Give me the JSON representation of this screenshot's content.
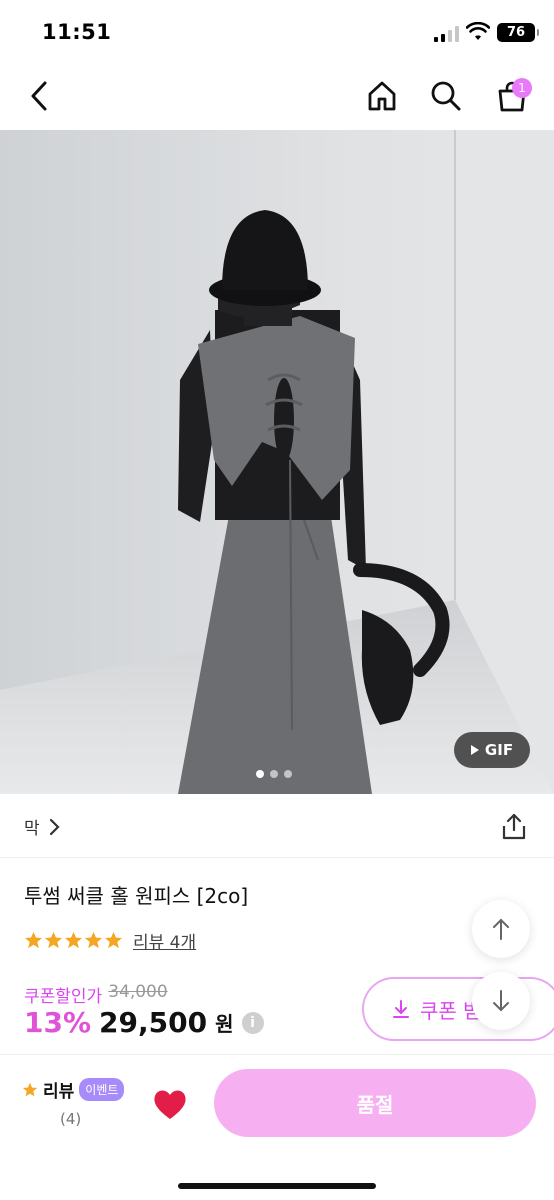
{
  "status_bar": {
    "time": "11:51",
    "battery": "76"
  },
  "nav": {
    "cart_count": "1"
  },
  "hero": {
    "gif_label": "GIF",
    "slide_count": 3,
    "active_slide": 0
  },
  "brand": {
    "name": "막",
    "chevron": ">"
  },
  "product": {
    "title": "투썸 써클 홀 원피스 [2co]",
    "rating": 5,
    "review_link": "리뷰 4개",
    "coupon_price_label": "쿠폰할인가",
    "original_price": "34,000",
    "discount": "13%",
    "price": "29,500",
    "currency": "원",
    "info_icon": "i"
  },
  "coupon_button": {
    "label": "쿠폰 받"
  },
  "bottom_bar": {
    "review_label": "리뷰",
    "event_badge": "이벤트",
    "review_count": "(4)",
    "soldout_label": "품절"
  },
  "colors": {
    "accent": "#d946ef",
    "soldout": "#f6b0f2",
    "heart": "#e11d48",
    "star": "#f5a623"
  }
}
